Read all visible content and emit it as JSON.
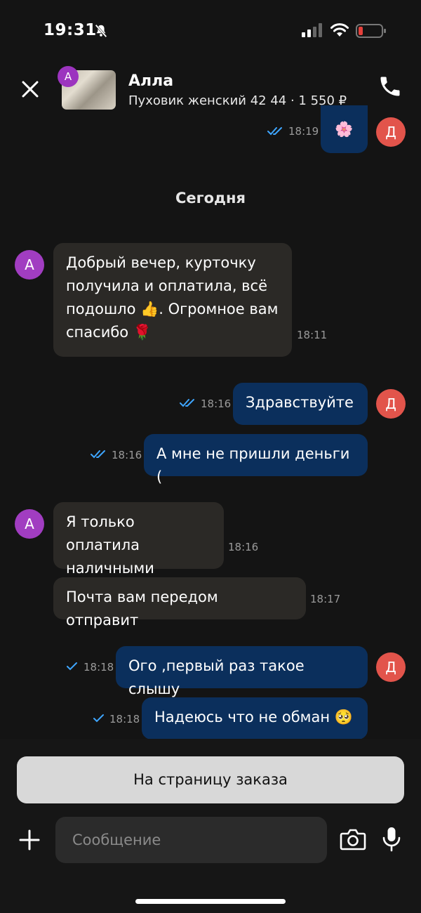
{
  "status": {
    "time": "19:31",
    "icons": [
      "bell-muted-icon",
      "signal-icon",
      "wifi-icon",
      "battery-low-icon"
    ],
    "battery_color": "#e5403b"
  },
  "header": {
    "name": "Алла",
    "subtitle": "Пуховик женский 42 44 · 1 550 ₽",
    "thumb_avatar": "А"
  },
  "date_separator": "Сегодня",
  "messages": [
    {
      "dir": "out",
      "text": "🌸",
      "time": "18:19",
      "avatar": "Д",
      "read": true
    },
    {
      "dir": "in",
      "text": "Добрый вечер, курточку получила и оплатила, всё подошло 👍. Огромное вам спасибо 🌹",
      "time": "18:11",
      "avatar": "А"
    },
    {
      "dir": "out",
      "text": "Здравствуйте",
      "time": "18:16",
      "avatar": "Д",
      "read": true
    },
    {
      "dir": "out",
      "text": "А мне не пришли деньги (",
      "time": "18:16",
      "read": true
    },
    {
      "dir": "in",
      "text": "Я только оплатила наличными",
      "time": "18:16",
      "avatar": "А"
    },
    {
      "dir": "in",
      "text": "Почта вам передом отправит",
      "time": "18:17"
    },
    {
      "dir": "out",
      "text": "Ого ,первый раз такое слышу",
      "time": "18:18",
      "avatar": "Д",
      "read": false
    },
    {
      "dir": "out",
      "text": "Надеюсь что не обман 🥺",
      "time": "18:18",
      "read": false
    }
  ],
  "order_button": "На страницу заказа",
  "composer": {
    "placeholder": "Сообщение"
  },
  "colors": {
    "incoming": "#2b2926",
    "outgoing": "#0b2f5c",
    "check": "#3ea6ff",
    "avatar_a": "#a13dc1",
    "avatar_d": "#e2544b"
  }
}
